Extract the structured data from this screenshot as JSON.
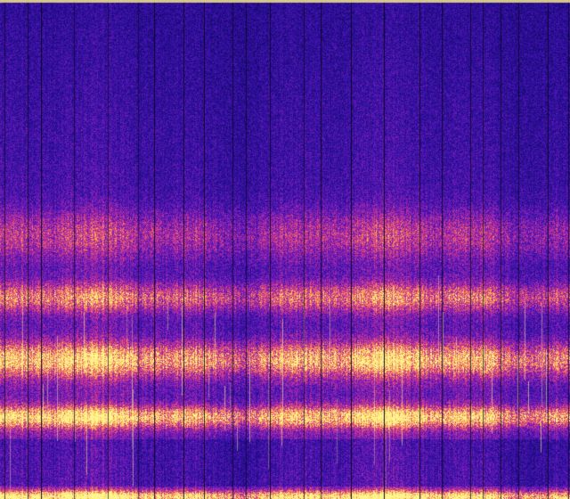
{
  "image": {
    "subject": "spectrogram",
    "colormap": "plasma-like",
    "palette": {
      "low": "#1b0a78",
      "low_mid": "#3a12a8",
      "mid": "#8a1fb5",
      "high_mid": "#e0407a",
      "high": "#f7a24a",
      "peak": "#fff58a",
      "separator": "#0a0420"
    },
    "bands_relative_intensity": [
      {
        "name": "bottom-edge",
        "intensity": 0.95
      },
      {
        "name": "band-1",
        "intensity": 0.85
      },
      {
        "name": "band-2",
        "intensity": 0.8
      },
      {
        "name": "band-3",
        "intensity": 0.6
      },
      {
        "name": "band-4",
        "intensity": 0.4
      }
    ]
  }
}
